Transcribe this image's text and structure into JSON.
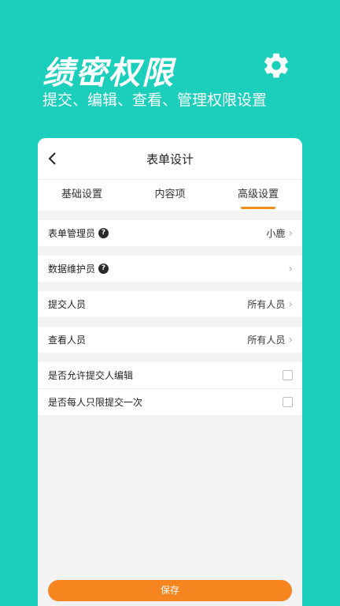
{
  "hero": {
    "title": "绩密权限",
    "subtitle": "提交、编辑、查看、管理权限设置",
    "icon": "gear-icon"
  },
  "nav": {
    "back_icon": "chevron-left-icon",
    "title": "表单设计"
  },
  "tabs": [
    {
      "label": "基础设置",
      "active": false
    },
    {
      "label": "内容项",
      "active": false
    },
    {
      "label": "高级设置",
      "active": true
    }
  ],
  "rows": {
    "form_admin": {
      "label": "表单管理员",
      "value": "小鹿"
    },
    "data_maintainer": {
      "label": "数据维护员",
      "value": ""
    },
    "submitters": {
      "label": "提交人员",
      "value": "所有人员"
    },
    "viewers": {
      "label": "查看人员",
      "value": "所有人员"
    },
    "allow_edit": {
      "label": "是否允许提交人编辑",
      "checked": false
    },
    "once_only": {
      "label": "是否每人只限提交一次",
      "checked": false
    }
  },
  "help_glyph": "?",
  "chevron_glyph": "›",
  "save_label": "保存",
  "colors": {
    "background": "#1ccfbd",
    "accent": "#f38a1f",
    "save_button": "#f6851f"
  }
}
